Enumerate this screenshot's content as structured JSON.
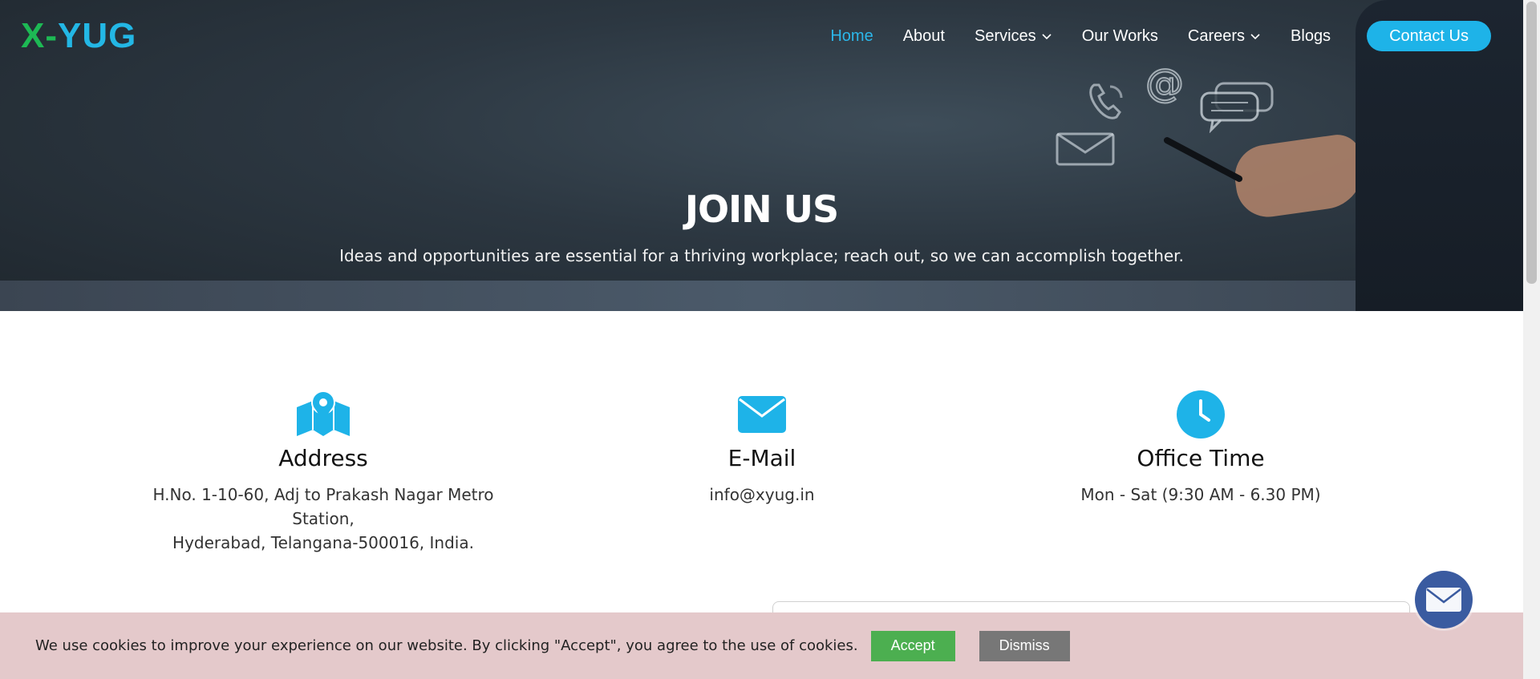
{
  "header": {
    "logo_part1": "X-",
    "logo_part2": "YUG",
    "nav": [
      {
        "label": "Home"
      },
      {
        "label": "About"
      },
      {
        "label": "Services"
      },
      {
        "label": "Our Works"
      },
      {
        "label": "Careers"
      },
      {
        "label": "Blogs"
      }
    ],
    "contact_label": "Contact Us"
  },
  "hero": {
    "title": "JOIN US",
    "subtitle": "Ideas and opportunities are essential for a thriving workplace; reach out, so we can accomplish together."
  },
  "info": {
    "address": {
      "heading": "Address",
      "line1": "H.No. 1-10-60, Adj to Prakash Nagar Metro Station,",
      "line2": "Hyderabad, Telangana-500016, India.",
      "icon": "map-pin-icon"
    },
    "email": {
      "heading": "E-Mail",
      "value": "info@xyug.in",
      "icon": "envelope-icon"
    },
    "hours": {
      "heading": "Office Time",
      "value": "Mon - Sat (9:30 AM - 6.30 PM)",
      "icon": "clock-icon"
    }
  },
  "cookie": {
    "text": "We use cookies to improve your experience on our website. By clicking \"Accept\", you agree to the use of cookies.",
    "accept_label": "Accept",
    "dismiss_label": "Dismiss"
  },
  "colors": {
    "accent": "#1eb3e8",
    "logo_green": "#1db954",
    "accept_green": "#4caf50",
    "dismiss_gray": "#777777",
    "cookie_bg": "#e4c9cb",
    "fab_blue": "#3a5ba0"
  },
  "fab": {
    "icon": "mail-icon"
  }
}
